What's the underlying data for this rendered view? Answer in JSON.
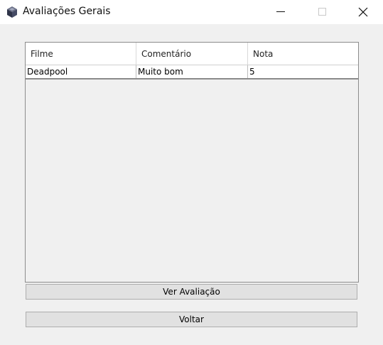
{
  "window": {
    "title": "Avaliações Gerais",
    "icons": {
      "app": "cube-app-icon",
      "minimize": "minimize-icon",
      "maximize": "maximize-icon",
      "close": "close-icon"
    }
  },
  "table": {
    "columns": [
      "Filme",
      "Comentário",
      "Nota"
    ],
    "rows": [
      [
        "Deadpool",
        "Muito bom",
        "5"
      ]
    ]
  },
  "buttons": {
    "view_review": "Ver Avaliação",
    "back": "Voltar"
  }
}
